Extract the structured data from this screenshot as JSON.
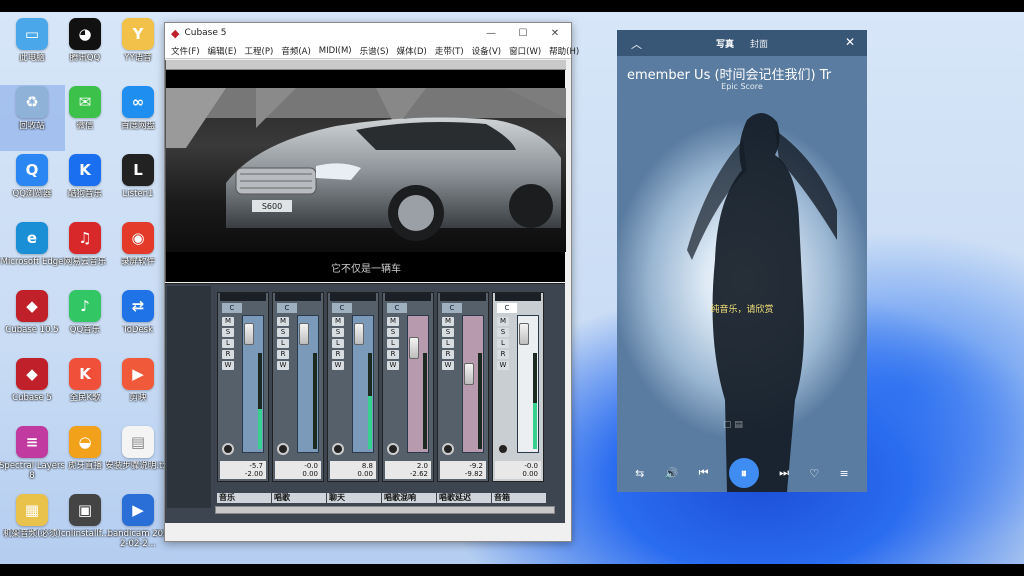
{
  "desktop_icons": [
    {
      "label": "此电脑",
      "color": "#4aa8ea",
      "glyph": "▭"
    },
    {
      "label": "腾讯QQ",
      "color": "#111111",
      "glyph": "◕"
    },
    {
      "label": "YY语音",
      "color": "#f2c14a",
      "glyph": "Y"
    },
    {
      "label": "回收站",
      "color": "#8fb3d8",
      "glyph": "♻"
    },
    {
      "label": "微信",
      "color": "#3cc24a",
      "glyph": "✉"
    },
    {
      "label": "百度网盘",
      "color": "#1e8ef0",
      "glyph": "∞"
    },
    {
      "label": "QQ浏览器",
      "color": "#2a86f2",
      "glyph": "Q"
    },
    {
      "label": "酷狗音乐",
      "color": "#1a6ff0",
      "glyph": "K"
    },
    {
      "label": "Listen1",
      "color": "#222222",
      "glyph": "L"
    },
    {
      "label": "Microsoft Edge",
      "color": "#1b8fd6",
      "glyph": "e"
    },
    {
      "label": "网易云音乐",
      "color": "#d8282a",
      "glyph": "♫"
    },
    {
      "label": "录屏软件",
      "color": "#e33a2a",
      "glyph": "◉"
    },
    {
      "label": "Cubase 10.5",
      "color": "#c0202a",
      "glyph": "◆"
    },
    {
      "label": "QQ音乐",
      "color": "#32c664",
      "glyph": "♪"
    },
    {
      "label": "ToDesk",
      "color": "#1f73e6",
      "glyph": "⇄"
    },
    {
      "label": "Cubase 5",
      "color": "#c0202a",
      "glyph": "◆"
    },
    {
      "label": "全民K歌",
      "color": "#f0503a",
      "glyph": "K"
    },
    {
      "label": "剪映",
      "color": "#f05a3a",
      "glyph": "▶"
    },
    {
      "label": "Spectral Layers 8",
      "color": "#c03aa0",
      "glyph": "≡"
    },
    {
      "label": "虎牙直播",
      "color": "#f2a21a",
      "glyph": "◒"
    },
    {
      "label": "安装步骤说明.txt",
      "color": "#f4f4f4",
      "glyph": "▤"
    },
    {
      "label": "机架音频(必须)",
      "color": "#e8c24a",
      "glyph": "▦"
    },
    {
      "label": "cnlinstallf...",
      "color": "#444444",
      "glyph": "▣"
    },
    {
      "label": "bandicam 2022-02-2...",
      "color": "#2a6fd8",
      "glyph": "▶"
    }
  ],
  "cubase": {
    "app_title": "Cubase 5",
    "window_buttons": [
      "—",
      "☐",
      "✕"
    ],
    "menus": [
      "文件(F)",
      "编辑(E)",
      "工程(P)",
      "音频(A)",
      "MIDI(M)",
      "乐谱(S)",
      "媒体(D)",
      "走带(T)",
      "设备(V)",
      "窗口(W)",
      "帮助(H)"
    ],
    "video": {
      "subtitle": "它不仅是一辆车",
      "plate": "S600"
    },
    "mixer": {
      "side_buttons": [
        "M",
        "S",
        "L",
        "R",
        "W"
      ],
      "channels": [
        {
          "name": "音乐",
          "number": "1",
          "c": "C",
          "val_top": "-5.7",
          "val_bottom": "-2.00",
          "val_left": "",
          "meter": 0.42,
          "color": "blue"
        },
        {
          "name": "唱歌",
          "number": "2",
          "c": "C",
          "val_top": "-0.0",
          "val_bottom": "0.00",
          "val_left": "",
          "meter": 0.0,
          "color": "blue"
        },
        {
          "name": "聊天",
          "number": "3",
          "c": "C",
          "val_top": "8.8",
          "val_bottom": "0.00",
          "val_left": "",
          "meter": 0.55,
          "color": "blue"
        },
        {
          "name": "唱歌混响",
          "number": "4",
          "c": "C",
          "val_top": "2.0",
          "val_bottom": "-2.62",
          "val_left": "",
          "meter": 0.0,
          "color": "pink"
        },
        {
          "name": "唱歌延迟",
          "number": "5",
          "c": "C",
          "val_top": "-9.2",
          "val_bottom": "-9.82",
          "val_left": "",
          "meter": 0.0,
          "color": "pink"
        },
        {
          "name": "音箱",
          "number": "",
          "c": "C",
          "val_top": "-0.0",
          "val_bottom": "0.00",
          "val_left": "",
          "meter": 0.48,
          "color": "master"
        }
      ]
    }
  },
  "player": {
    "tabs": [
      "写真",
      "封面"
    ],
    "song_title": "emember Us (时间会记住我们)   Tr",
    "artist": "Epic Score",
    "lyric": "纯音乐，请欣赏",
    "controls": [
      "⇆",
      "🔊",
      "⏮",
      "⏸",
      "⏭",
      "♡",
      "≡"
    ]
  }
}
